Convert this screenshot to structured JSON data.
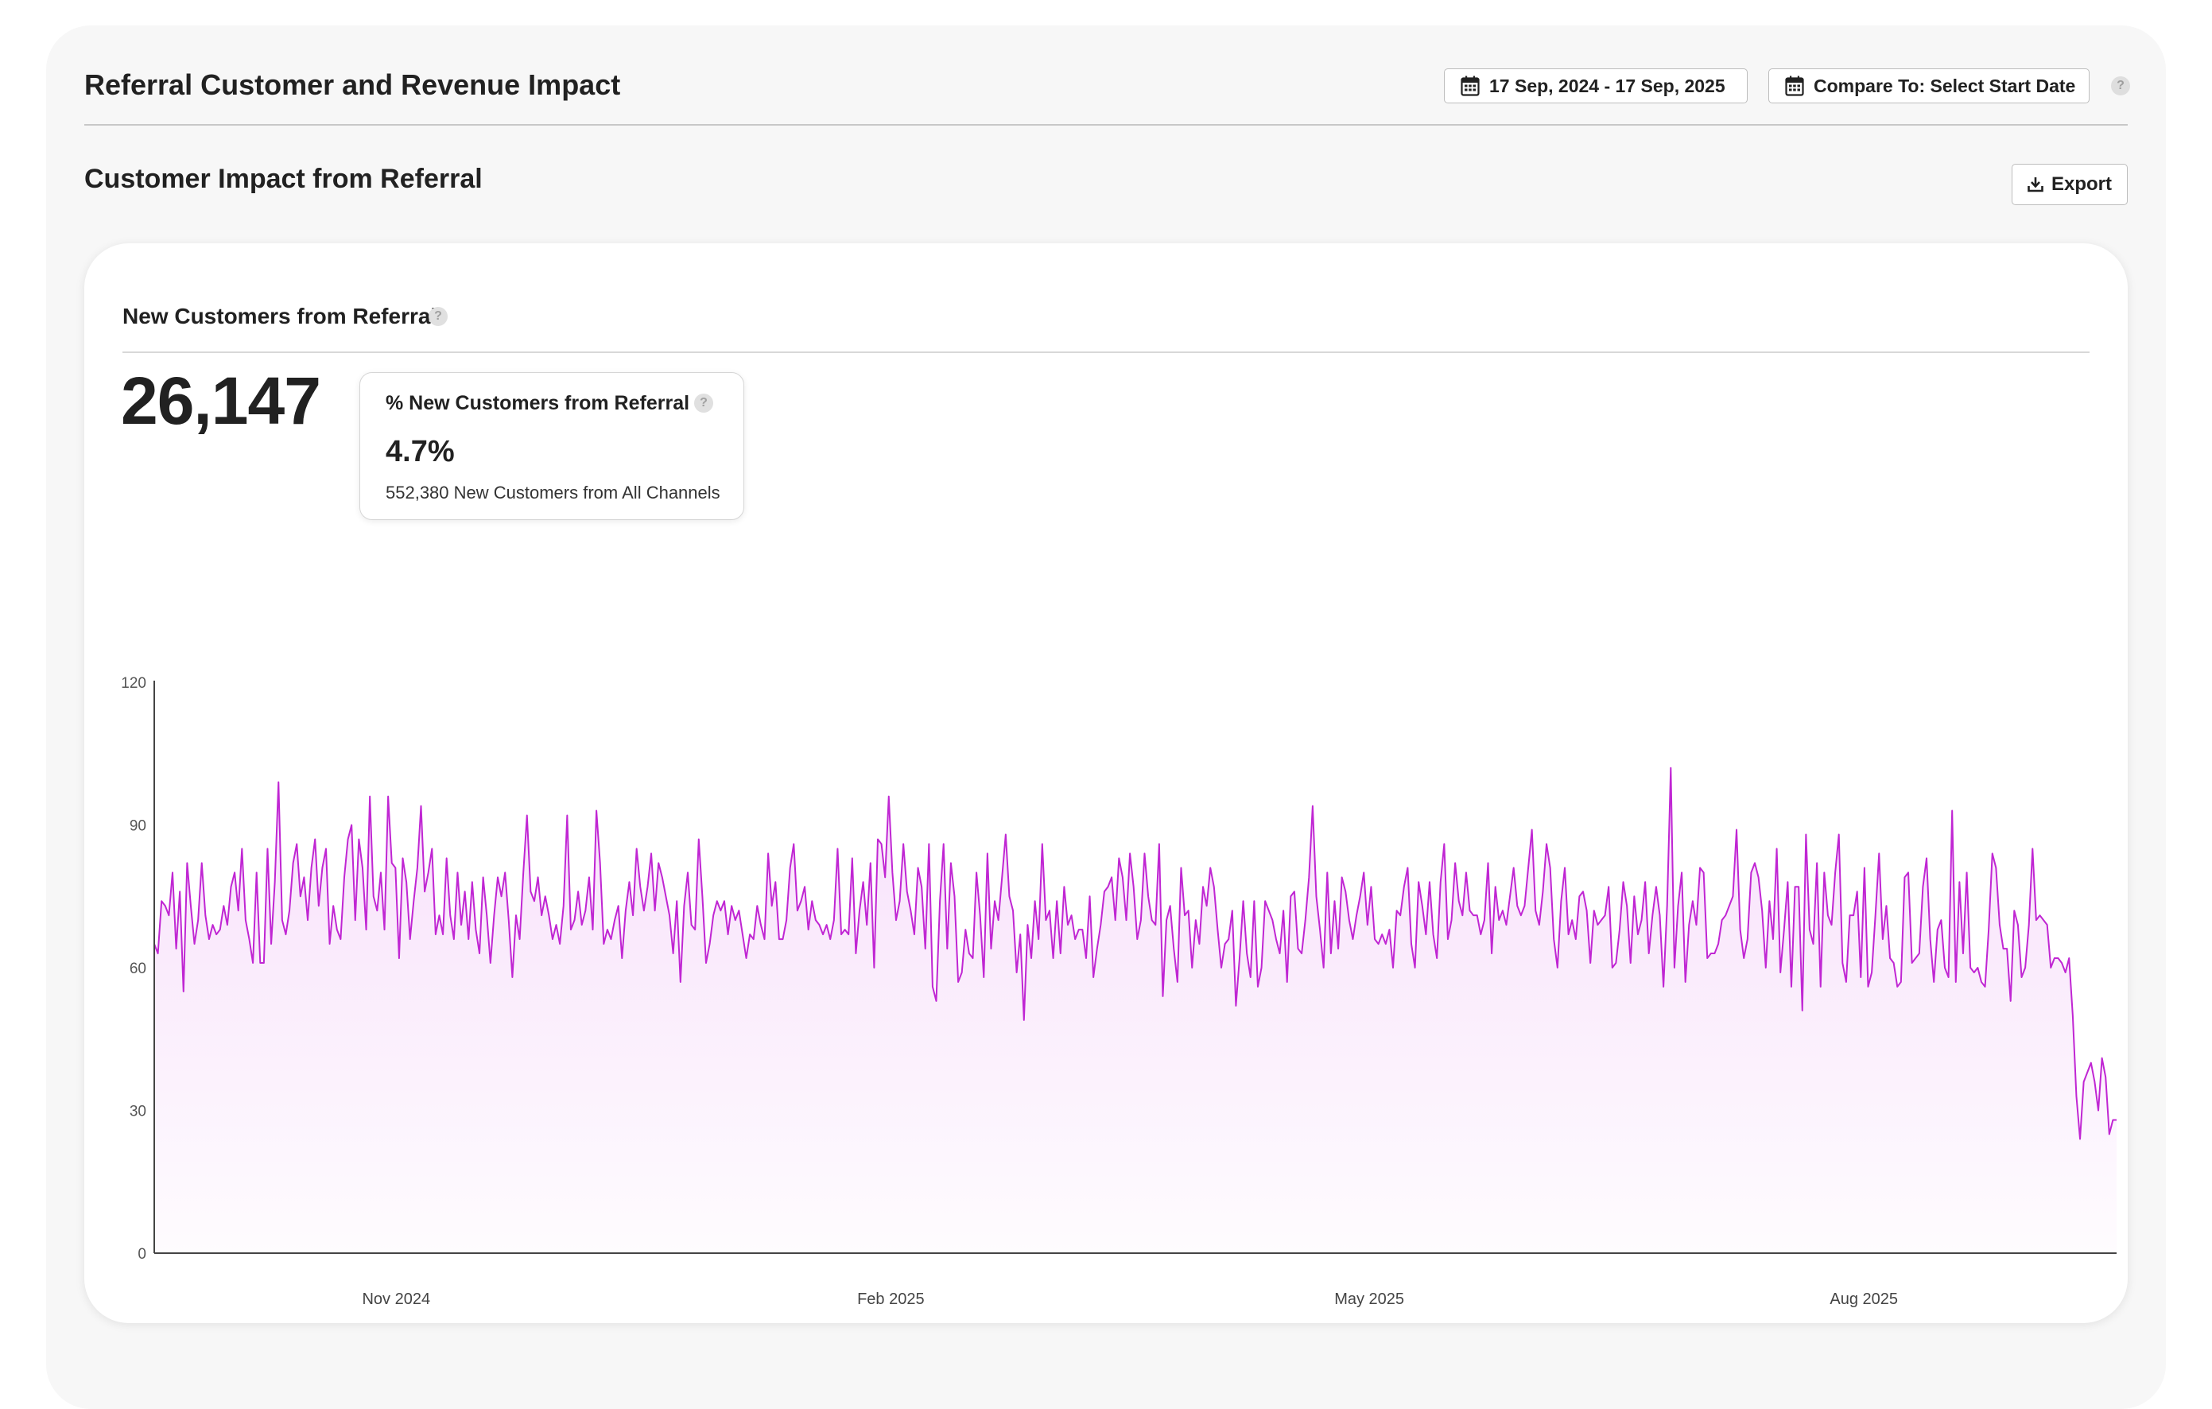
{
  "header": {
    "title": "Referral Customer and Revenue Impact",
    "date_range": "17 Sep, 2024 - 17 Sep, 2025",
    "compare": "Compare To: Select Start Date",
    "help": "?"
  },
  "section": {
    "title": "Customer Impact from Referral",
    "export_label": "Export"
  },
  "card": {
    "title": "New Customers from Referral",
    "help": "?",
    "total": "26,147",
    "stat": {
      "label": "% New Customers from Referral",
      "help": "?",
      "value": "4.7%",
      "sub": "552,380 New Customers from All Channels"
    }
  },
  "colors": {
    "line": "#c026d3",
    "fill_top": "#f5d6f9",
    "text": "#212121",
    "axis": "#555555"
  },
  "chart_data": {
    "type": "area",
    "x_start": "2024-09-17",
    "x_end": "2025-09-17",
    "ylim": [
      0,
      120
    ],
    "yticks": [
      0,
      30,
      60,
      90,
      120
    ],
    "xticks": [
      {
        "date": "2024-11-01",
        "label": "Nov 2024"
      },
      {
        "date": "2025-02-01",
        "label": "Feb 2025"
      },
      {
        "date": "2025-05-01",
        "label": "May 2025"
      },
      {
        "date": "2025-08-01",
        "label": "Aug 2025"
      }
    ],
    "values": [
      65,
      63,
      74,
      73,
      71,
      80,
      64,
      76,
      55,
      82,
      73,
      65,
      70,
      82,
      71,
      66,
      69,
      67,
      68,
      73,
      69,
      77,
      80,
      72,
      85,
      70,
      66,
      61,
      80,
      61,
      61,
      85,
      65,
      78,
      99,
      70,
      67,
      72,
      82,
      86,
      75,
      79,
      70,
      81,
      87,
      73,
      81,
      85,
      65,
      73,
      68,
      66,
      79,
      87,
      90,
      70,
      87,
      81,
      68,
      96,
      75,
      72,
      80,
      68,
      96,
      82,
      81,
      62,
      83,
      78,
      66,
      74,
      81,
      94,
      76,
      80,
      85,
      67,
      71,
      67,
      83,
      71,
      66,
      80,
      69,
      76,
      66,
      78,
      68,
      63,
      79,
      71,
      61,
      71,
      79,
      75,
      80,
      70,
      58,
      71,
      66,
      80,
      92,
      76,
      74,
      79,
      71,
      75,
      71,
      66,
      69,
      65,
      73,
      92,
      68,
      70,
      76,
      69,
      72,
      79,
      68,
      93,
      82,
      65,
      68,
      66,
      70,
      73,
      62,
      72,
      78,
      71,
      85,
      77,
      72,
      77,
      84,
      72,
      82,
      79,
      75,
      71,
      63,
      74,
      57,
      73,
      80,
      69,
      68,
      87,
      75,
      61,
      65,
      71,
      74,
      72,
      74,
      67,
      73,
      70,
      72,
      67,
      62,
      67,
      66,
      73,
      69,
      66,
      84,
      73,
      78,
      66,
      66,
      70,
      81,
      86,
      72,
      74,
      77,
      68,
      74,
      70,
      69,
      67,
      69,
      66,
      70,
      85,
      67,
      68,
      67,
      83,
      63,
      72,
      78,
      69,
      82,
      60,
      87,
      86,
      79,
      96,
      80,
      70,
      74,
      86,
      76,
      72,
      67,
      81,
      77,
      64,
      86,
      56,
      53,
      74,
      86,
      64,
      82,
      75,
      57,
      59,
      68,
      63,
      62,
      80,
      71,
      58,
      84,
      64,
      74,
      70,
      79,
      88,
      75,
      72,
      59,
      67,
      49,
      69,
      62,
      74,
      66,
      86,
      70,
      72,
      62,
      74,
      63,
      77,
      69,
      71,
      66,
      68,
      68,
      62,
      75,
      58,
      64,
      69,
      76,
      77,
      79,
      70,
      83,
      79,
      70,
      84,
      77,
      66,
      70,
      84,
      75,
      70,
      69,
      86,
      54,
      70,
      73,
      64,
      57,
      81,
      71,
      72,
      60,
      70,
      65,
      77,
      73,
      81,
      77,
      68,
      60,
      65,
      66,
      72,
      52,
      62,
      74,
      63,
      58,
      74,
      56,
      60,
      74,
      72,
      70,
      66,
      63,
      72,
      57,
      75,
      76,
      64,
      63,
      70,
      79,
      94,
      75,
      68,
      60,
      80,
      63,
      74,
      64,
      79,
      76,
      70,
      66,
      71,
      75,
      80,
      69,
      77,
      66,
      65,
      67,
      65,
      68,
      60,
      72,
      71,
      77,
      81,
      65,
      60,
      78,
      73,
      67,
      78,
      67,
      62,
      78,
      86,
      66,
      70,
      82,
      74,
      71,
      80,
      72,
      71,
      71,
      67,
      70,
      82,
      63,
      77,
      70,
      72,
      69,
      75,
      81,
      73,
      71,
      73,
      81,
      89,
      72,
      69,
      76,
      86,
      81,
      66,
      60,
      74,
      81,
      67,
      70,
      66,
      75,
      76,
      72,
      61,
      72,
      69,
      70,
      71,
      77,
      60,
      61,
      68,
      78,
      73,
      61,
      75,
      67,
      70,
      78,
      63,
      71,
      77,
      71,
      56,
      73,
      102,
      60,
      73,
      80,
      57,
      69,
      74,
      69,
      81,
      80,
      62,
      63,
      63,
      65,
      70,
      71,
      73,
      75,
      89,
      68,
      62,
      66,
      80,
      82,
      79,
      72,
      60,
      74,
      66,
      85,
      59,
      68,
      78,
      56,
      77,
      77,
      51,
      88,
      68,
      65,
      82,
      56,
      80,
      71,
      69,
      80,
      88,
      61,
      57,
      71,
      71,
      76,
      58,
      81,
      56,
      59,
      71,
      84,
      66,
      73,
      62,
      61,
      56,
      57,
      79,
      80,
      61,
      62,
      63,
      77,
      83,
      66,
      57,
      68,
      70,
      60,
      58,
      93,
      57,
      78,
      63,
      80,
      60,
      59,
      60,
      57,
      56,
      68,
      84,
      81,
      69,
      64,
      64,
      53,
      72,
      69,
      58,
      60,
      69,
      85,
      70,
      71,
      70,
      69,
      60,
      62,
      62,
      61,
      59,
      62,
      50,
      33,
      24,
      36,
      38,
      40,
      36,
      30,
      41,
      37,
      25,
      28,
      28
    ]
  }
}
